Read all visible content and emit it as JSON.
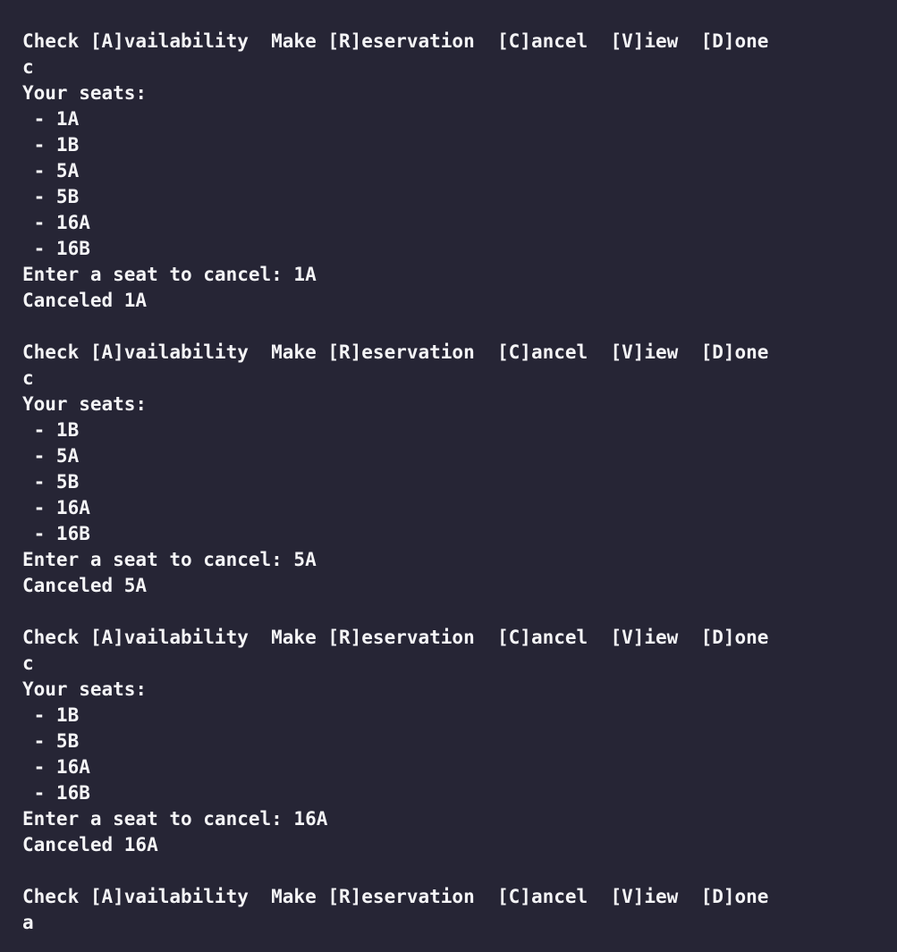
{
  "terminal": {
    "lines": [
      "Check [A]vailability  Make [R]eservation  [C]ancel  [V]iew  [D]one",
      "c",
      "Your seats:",
      " - 1A",
      " - 1B",
      " - 5A",
      " - 5B",
      " - 16A",
      " - 16B",
      "Enter a seat to cancel: 1A",
      "Canceled 1A",
      "",
      "Check [A]vailability  Make [R]eservation  [C]ancel  [V]iew  [D]one",
      "c",
      "Your seats:",
      " - 1B",
      " - 5A",
      " - 5B",
      " - 16A",
      " - 16B",
      "Enter a seat to cancel: 5A",
      "Canceled 5A",
      "",
      "Check [A]vailability  Make [R]eservation  [C]ancel  [V]iew  [D]one",
      "c",
      "Your seats:",
      " - 1B",
      " - 5B",
      " - 16A",
      " - 16B",
      "Enter a seat to cancel: 16A",
      "Canceled 16A",
      "",
      "Check [A]vailability  Make [R]eservation  [C]ancel  [V]iew  [D]one",
      "a"
    ]
  },
  "colors": {
    "background": "#262535",
    "text": "#f4f4f6"
  }
}
